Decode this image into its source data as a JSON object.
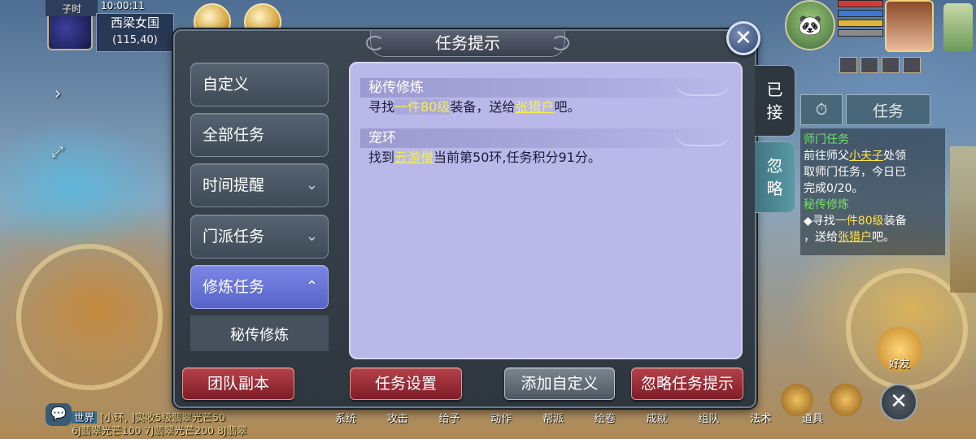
{
  "hud": {
    "time_label": "子时",
    "clock": "10:00:11",
    "map_name": "西梁女国",
    "coords": "(115,40)"
  },
  "dialog": {
    "title": "任务提示",
    "close_icon": "close-x-icon"
  },
  "categories": [
    {
      "label": "自定义",
      "expandable": false,
      "active": false
    },
    {
      "label": "全部任务",
      "expandable": false,
      "active": false
    },
    {
      "label": "时间提醒",
      "expandable": true,
      "active": false
    },
    {
      "label": "门派任务",
      "expandable": true,
      "active": false
    },
    {
      "label": "修炼任务",
      "expandable": true,
      "active": true
    }
  ],
  "subcategory": {
    "label": "秘传修炼"
  },
  "sections": [
    {
      "head": "秘传修炼",
      "body": {
        "pre": "寻找",
        "hl": "一件80级",
        "mid": "装备，送给",
        "link": "张猎户",
        "post": "吧。"
      }
    },
    {
      "head": "宠环",
      "body": {
        "pre": "找到",
        "link": "云游僧",
        "post": "当前第50环,任务积分91分。"
      }
    }
  ],
  "right_tabs": [
    {
      "label_top": "已",
      "label_bottom": "接",
      "active": true
    },
    {
      "label_top": "忽",
      "label_bottom": "略",
      "active": false
    }
  ],
  "buttons": {
    "team_dungeon": "团队副本",
    "task_settings": "任务设置",
    "add_custom": "添加自定义",
    "ignore_hints": "忽略任务提示"
  },
  "tracker": {
    "tab_task": "任务",
    "header1": "师门任务",
    "line1_pre": "前往师父",
    "line1_link": "小夫子",
    "line1_post": "处领",
    "line2": "取师门任务，今日已",
    "line3": "完成0/20。",
    "header2": "秘传修炼",
    "line4_pre": "◆寻找",
    "line4_hl": "一件80级",
    "line4_post": "装备",
    "line5_pre": "，送给",
    "line5_link": "张猎户",
    "line5_post": "吧。"
  },
  "chat": {
    "channel": "世界",
    "line1": "[小环, ]实收5级翡翠光芒50",
    "line2": "6J翡翠光芒100 7J翡翠光芒200 8J翡翠"
  },
  "bottom_menu": [
    "系统",
    "攻击",
    "给予",
    "动作",
    "帮派",
    "绘卷",
    "成就",
    "组队",
    "法术",
    "道具"
  ],
  "friend_label": "好友",
  "colors": {
    "highlight": "#f5f04a",
    "active_category": "#6b76da",
    "content_bg": "#b9b8e8",
    "red_button": "#9a2e38"
  }
}
